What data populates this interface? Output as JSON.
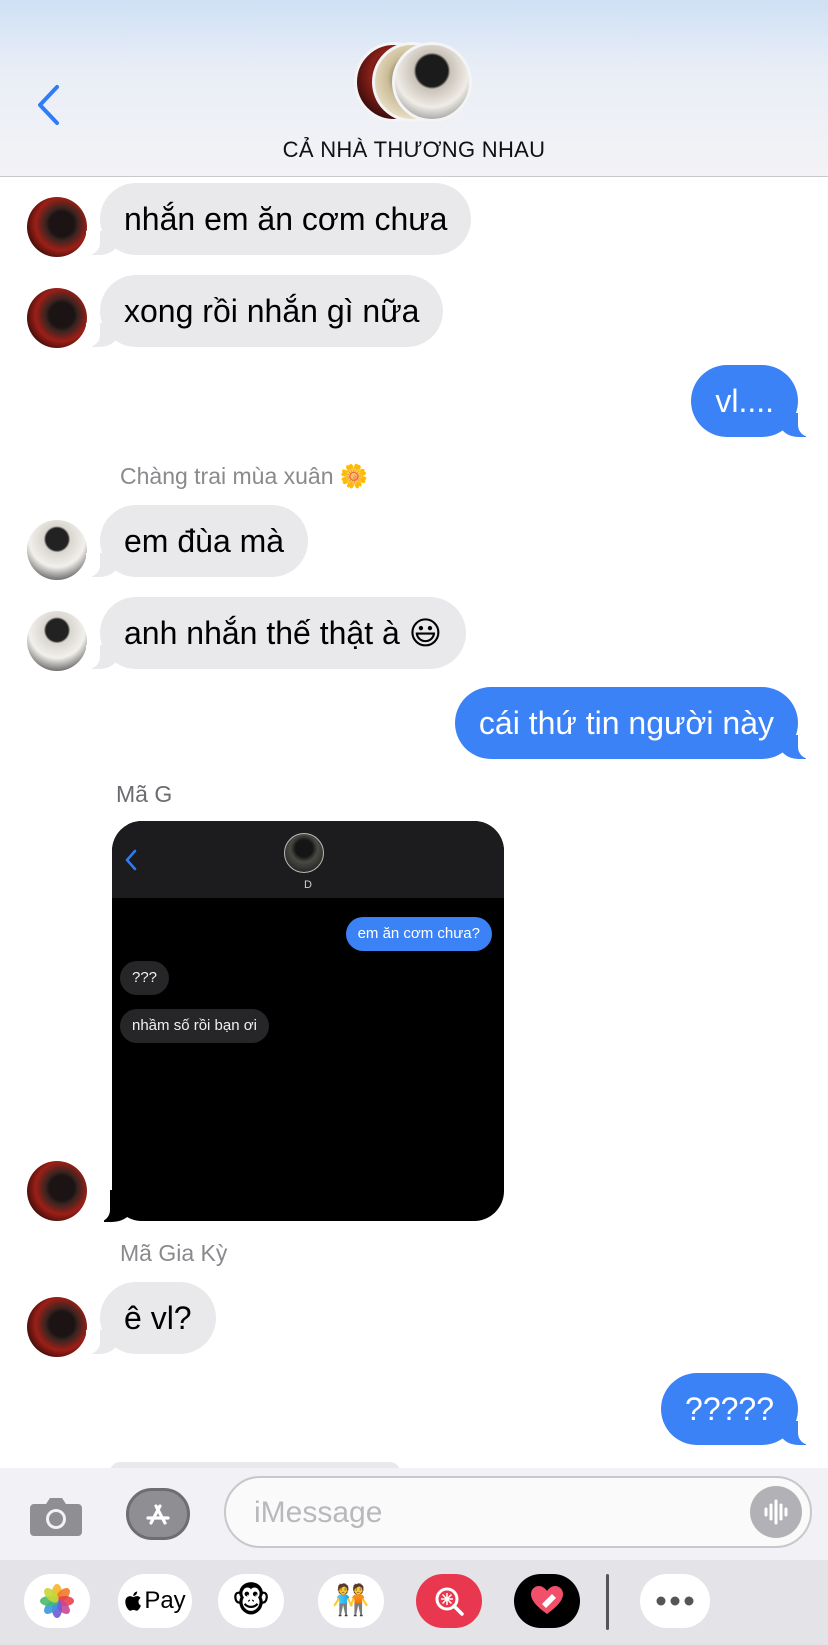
{
  "header": {
    "back_icon": "chevron-left-icon",
    "group_name": "CẢ NHÀ THƯƠNG NHAU"
  },
  "messages": [
    {
      "direction": "in",
      "avatar": "red",
      "text": "nhắn em ăn cơm chưa"
    },
    {
      "direction": "in",
      "avatar": "red",
      "text": "xong rồi nhắn gì nữa"
    },
    {
      "direction": "out",
      "text": "vl...."
    },
    {
      "direction": "in",
      "sender": "Chàng trai mùa xuân 🌼",
      "avatar": "white",
      "text": "em đùa mà"
    },
    {
      "direction": "in",
      "avatar": "white",
      "text": "anh nhắn thế thật à 😃"
    },
    {
      "direction": "out",
      "text": "cái thứ tin người này"
    },
    {
      "direction": "in",
      "sender": "Mã G",
      "avatar": "red",
      "attachment": "screenshot"
    },
    {
      "direction": "in",
      "sender": "Mã Gia Kỳ",
      "avatar": "red",
      "text": "ê vl?"
    },
    {
      "direction": "out",
      "text": "?????"
    }
  ],
  "screenshot": {
    "contact_name": "D",
    "messages": [
      {
        "direction": "out",
        "text": "em ăn cơm chưa?"
      },
      {
        "direction": "in",
        "text": "???"
      },
      {
        "direction": "in",
        "text": "nhầm số rồi bạn ơi"
      }
    ]
  },
  "input_bar": {
    "placeholder": "iMessage",
    "value": ""
  },
  "app_drawer": {
    "apps": [
      "photos-icon",
      "apple-pay-icon",
      "animoji-icon",
      "memoji-icon",
      "image-search-icon",
      "digital-touch-icon",
      "more-icon"
    ],
    "apple_pay_label": "Pay"
  },
  "colors": {
    "outgoing_bubble": "#3b82f6",
    "incoming_bubble": "#e9e9eb",
    "sender_label": "#8a8a8e"
  }
}
